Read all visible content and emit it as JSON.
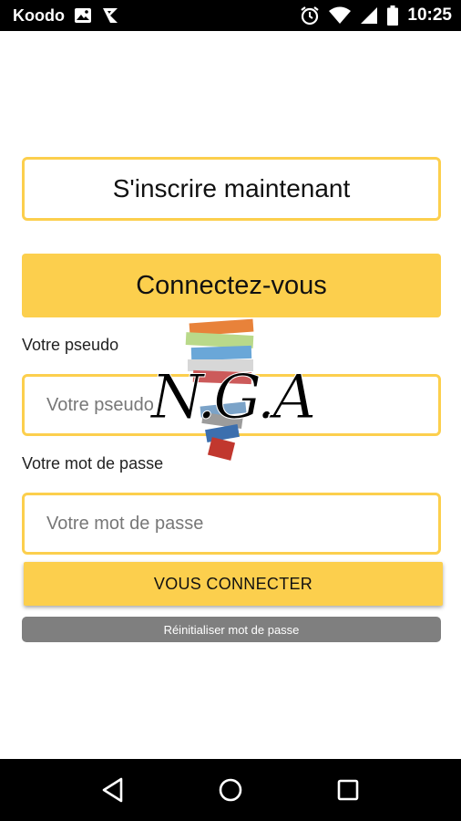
{
  "status_bar": {
    "carrier": "Koodo",
    "time": "10:25",
    "icons": [
      "image-icon",
      "app-notification-icon",
      "alarm-icon",
      "wifi-icon",
      "signal-icon",
      "battery-icon"
    ]
  },
  "signup": {
    "label": "S'inscrire maintenant"
  },
  "login": {
    "header": "Connectez-vous",
    "username_label": "Votre pseudo",
    "username_placeholder": "Votre pseudo",
    "username_value": "",
    "password_label": "Votre mot de passe",
    "password_placeholder": "Votre mot de passe",
    "password_value": "",
    "submit_label": "VOUS CONNECTER",
    "reset_label": "Réinitialiser mot de passe"
  },
  "logo": {
    "text": "N.G.A"
  },
  "nav": {
    "icons": [
      "back-icon",
      "home-icon",
      "recents-icon"
    ]
  },
  "colors": {
    "accent": "#fccf4d",
    "reset_bg": "#7f7f7f",
    "bars": "#000000"
  }
}
